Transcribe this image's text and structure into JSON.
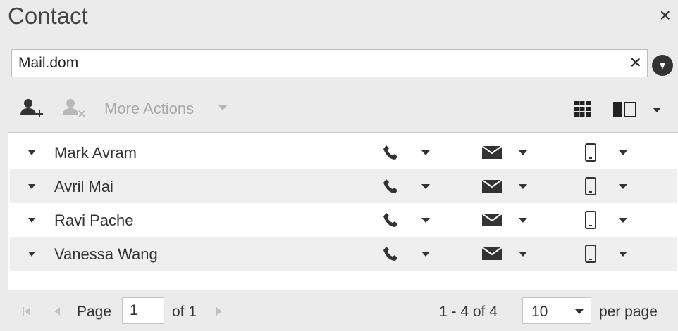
{
  "window": {
    "title": "Contact",
    "close_glyph": "×"
  },
  "search": {
    "value": "Mail.dom",
    "placeholder": "",
    "clear_glyph": "×"
  },
  "toolbar": {
    "more_actions_label": "More Actions"
  },
  "icons": {
    "add_contact": "add-contact-icon",
    "remove_contact": "remove-contact-icon",
    "grid_view": "grid-view-icon",
    "split_view": "split-view-icon",
    "phone": "phone-icon",
    "email": "email-icon",
    "mobile": "mobile-icon"
  },
  "contacts": [
    {
      "name": "Mark Avram"
    },
    {
      "name": "Avril Mai"
    },
    {
      "name": "Ravi Pache"
    },
    {
      "name": "Vanessa Wang"
    }
  ],
  "pager": {
    "page_label": "Page",
    "page_value": "1",
    "of_label": "of 1",
    "range_label": "1 - 4 of 4",
    "per_page_value": "10",
    "per_page_label": "per page"
  },
  "colors": {
    "background": "#ebebeb",
    "row_alt": "#efefef",
    "disabled": "#a8a8a8"
  }
}
